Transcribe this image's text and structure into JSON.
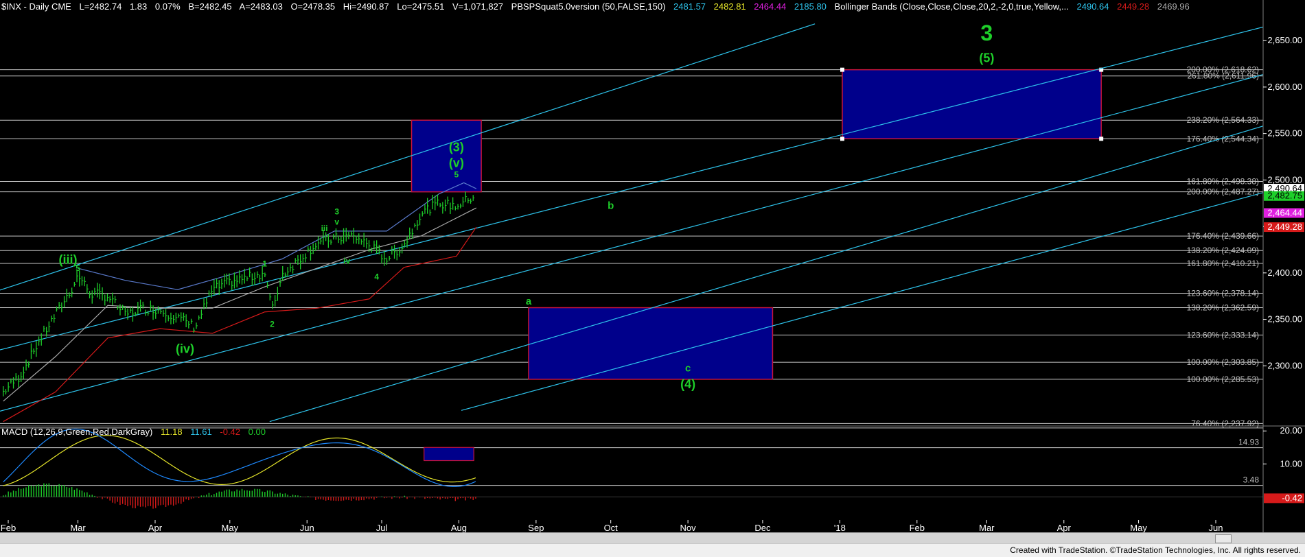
{
  "header": {
    "symbol": "$INX - Daily  CME",
    "last": "L=2482.74",
    "change": "1.83",
    "change_pct": "0.07%",
    "bid": "B=2482.45",
    "ask": "A=2483.03",
    "open": "O=2478.35",
    "high": "Hi=2490.87",
    "low": "Lo=2475.51",
    "volume": "V=1,071,827",
    "study1": "PBSPSquat5.0version (50,FALSE,150)",
    "study1_vals": [
      "2481.57",
      "2482.81",
      "2464.44",
      "2185.80"
    ],
    "study2": "Bollinger Bands (Close,Close,Close,20,2,-2,0,true,Yellow,...",
    "study2_vals": [
      "2490.64",
      "2449.28",
      "2469.96"
    ]
  },
  "macd_header": {
    "label": "MACD (12,26,9,Green,Red,DarkGray)",
    "vals": [
      "11.18",
      "11.61",
      "-0.42",
      "0.00"
    ]
  },
  "footer": {
    "text": "Created with TradeStation. ©TradeStation Technologies, Inc. All rights reserved."
  },
  "colors": {
    "background": "#000000",
    "channel": "#2ec4ec",
    "fib_line": "#c8c8c8",
    "box_fill": "#00008b",
    "box_border": "#c8143c",
    "wave_green": "#1ecf2a",
    "bb_mid": "#a9a9a9",
    "bb_upper": "#5a7acc",
    "bb_lower": "#d61a1a",
    "macd_line": "#1e8aff",
    "signal_line": "#e6e62a",
    "hist_pos": "#1ecf2a",
    "hist_neg": "#d61a1a"
  },
  "chart_data": [
    {
      "type": "line",
      "title": "$INX - Daily",
      "x_axis_labels": [
        "Feb",
        "Mar",
        "Apr",
        "May",
        "Jun",
        "Jul",
        "Aug",
        "Sep",
        "Oct",
        "Nov",
        "Dec",
        "'18",
        "Feb",
        "Mar",
        "Apr",
        "May",
        "Jun"
      ],
      "y_ticks": [
        "2,650.00",
        "2,600.00",
        "2,550.00",
        "2,500.00",
        "2,450.00",
        "2,400.00",
        "2,350.00",
        "2,300.00"
      ],
      "ylim": [
        2236,
        2680
      ],
      "price_path": [
        [
          "2017-01-30",
          2272
        ],
        [
          "2017-02-06",
          2290
        ],
        [
          "2017-02-13",
          2325
        ],
        [
          "2017-02-20",
          2355
        ],
        [
          "2017-02-27",
          2385
        ],
        [
          "2017-03-01",
          2398
        ],
        [
          "2017-03-06",
          2378
        ],
        [
          "2017-03-13",
          2375
        ],
        [
          "2017-03-20",
          2355
        ],
        [
          "2017-03-27",
          2362
        ],
        [
          "2017-04-03",
          2360
        ],
        [
          "2017-04-10",
          2352
        ],
        [
          "2017-04-17",
          2342
        ],
        [
          "2017-04-24",
          2382
        ],
        [
          "2017-05-01",
          2390
        ],
        [
          "2017-05-08",
          2395
        ],
        [
          "2017-05-15",
          2400
        ],
        [
          "2017-05-18",
          2360
        ],
        [
          "2017-05-22",
          2398
        ],
        [
          "2017-05-29",
          2415
        ],
        [
          "2017-06-05",
          2432
        ],
        [
          "2017-06-12",
          2437
        ],
        [
          "2017-06-19",
          2440
        ],
        [
          "2017-06-26",
          2430
        ],
        [
          "2017-07-03",
          2415
        ],
        [
          "2017-07-10",
          2430
        ],
        [
          "2017-07-17",
          2465
        ],
        [
          "2017-07-24",
          2475
        ],
        [
          "2017-07-31",
          2472
        ],
        [
          "2017-08-07",
          2482.74
        ]
      ],
      "bollinger": {
        "upper": [
          [
            "2017-03-01",
            2405
          ],
          [
            "2017-03-20",
            2392
          ],
          [
            "2017-04-10",
            2382
          ],
          [
            "2017-05-01",
            2398
          ],
          [
            "2017-05-22",
            2415
          ],
          [
            "2017-06-12",
            2445
          ],
          [
            "2017-07-03",
            2445
          ],
          [
            "2017-07-24",
            2485
          ],
          [
            "2017-08-03",
            2497
          ],
          [
            "2017-08-08",
            2490.64
          ]
        ],
        "middle": [
          [
            "2017-01-30",
            2262
          ],
          [
            "2017-02-20",
            2310
          ],
          [
            "2017-03-13",
            2365
          ],
          [
            "2017-04-03",
            2362
          ],
          [
            "2017-04-24",
            2362
          ],
          [
            "2017-05-15",
            2385
          ],
          [
            "2017-06-05",
            2405
          ],
          [
            "2017-06-26",
            2425
          ],
          [
            "2017-07-17",
            2440
          ],
          [
            "2017-08-08",
            2469.96
          ]
        ],
        "lower": [
          [
            "2017-01-30",
            2240
          ],
          [
            "2017-02-20",
            2272
          ],
          [
            "2017-03-13",
            2330
          ],
          [
            "2017-04-03",
            2340
          ],
          [
            "2017-04-24",
            2335
          ],
          [
            "2017-05-15",
            2358
          ],
          [
            "2017-06-05",
            2362
          ],
          [
            "2017-06-26",
            2372
          ],
          [
            "2017-07-10",
            2406
          ],
          [
            "2017-07-31",
            2418
          ],
          [
            "2017-08-08",
            2449.28
          ]
        ]
      },
      "fib_levels": [
        {
          "label": "200.00% (2,618.62)",
          "value": 2618.62
        },
        {
          "label": "261.80% (2,611.96)",
          "value": 2611.96
        },
        {
          "label": "238.20% (2,564.33)",
          "value": 2564.33
        },
        {
          "label": "176.40% (2,544.34)",
          "value": 2544.34
        },
        {
          "label": "161.80% (2,498.38)",
          "value": 2498.38
        },
        {
          "label": "200.00% (2,487.27)",
          "value": 2487.27
        },
        {
          "label": "176.40% (2,439.66)",
          "value": 2439.66
        },
        {
          "label": "138.20% (2,424.09)",
          "value": 2424.09
        },
        {
          "label": "161.80% (2,410.21)",
          "value": 2410.21
        },
        {
          "label": "123.60% (2,378.14)",
          "value": 2378.14
        },
        {
          "label": "138.20% (2,362.59)",
          "value": 2362.59
        },
        {
          "label": "123.60% (2,333.14)",
          "value": 2333.14
        },
        {
          "label": "100.00% (2,303.85)",
          "value": 2303.85
        },
        {
          "label": "100.00% (2,285.53)",
          "value": 2285.53
        },
        {
          "label": "76.40% (2,237.92)",
          "value": 2237.92
        }
      ],
      "target_boxes": [
        {
          "from": "2017-07-13",
          "to": "2017-08-10",
          "low": 2487.27,
          "high": 2564.33
        },
        {
          "from": "2017-08-29",
          "to": "2017-12-05",
          "low": 2285.53,
          "high": 2362.59
        },
        {
          "from": "2018-01-02",
          "to": "2018-04-16",
          "low": 2544.34,
          "high": 2618.62
        }
      ],
      "channel_lines": [
        {
          "from": [
            "2017-01-27",
            2380
          ],
          "to": [
            "2017-12-22",
            2668
          ]
        },
        {
          "from": [
            "2017-01-27",
            2316
          ],
          "to": [
            "2018-06-25",
            2668
          ]
        },
        {
          "from": [
            "2017-01-27",
            2250
          ],
          "to": [
            "2018-06-25",
            2617
          ]
        },
        {
          "from": [
            "2017-05-17",
            2240
          ],
          "to": [
            "2018-06-25",
            2562
          ]
        },
        {
          "from": [
            "2017-08-02",
            2252
          ],
          "to": [
            "2018-06-25",
            2490
          ]
        }
      ],
      "wave_labels": [
        {
          "text": "(iii)",
          "date": "2017-02-25",
          "value": 2410
        },
        {
          "text": "5",
          "date": "2017-03-01",
          "value": 2402
        },
        {
          "text": "(iv)",
          "date": "2017-04-13",
          "value": 2314
        },
        {
          "text": "1",
          "date": "2017-05-15",
          "value": 2407
        },
        {
          "text": "2",
          "date": "2017-05-18",
          "value": 2342
        },
        {
          "text": "iii",
          "date": "2017-06-08",
          "value": 2445
        },
        {
          "text": "3",
          "date": "2017-06-13",
          "value": 2463
        },
        {
          "text": "v",
          "date": "2017-06-13",
          "value": 2452
        },
        {
          "text": "iv",
          "date": "2017-06-17",
          "value": 2410
        },
        {
          "text": "4",
          "date": "2017-06-29",
          "value": 2393
        },
        {
          "text": "(3)",
          "date": "2017-07-31",
          "value": 2531
        },
        {
          "text": "(v)",
          "date": "2017-07-31",
          "value": 2514
        },
        {
          "text": "5",
          "date": "2017-07-31",
          "value": 2503
        },
        {
          "text": "b",
          "date": "2017-10-01",
          "value": 2469
        },
        {
          "text": "a",
          "date": "2017-08-29",
          "value": 2366
        },
        {
          "text": "c",
          "date": "2017-11-01",
          "value": 2294
        },
        {
          "text": "(4)",
          "date": "2017-11-01",
          "value": 2276
        },
        {
          "text": "3",
          "date": "2018-03-01",
          "value": 2650
        },
        {
          "text": "(5)",
          "date": "2018-03-01",
          "value": 2627
        }
      ],
      "price_flags": [
        {
          "text": "2,490.64",
          "value": 2490.64,
          "color": "#ffffff",
          "text_color": "#000000"
        },
        {
          "text": "2,482.75",
          "value": 2482.75,
          "color": "#1ecf2a",
          "text_color": "#000000"
        },
        {
          "text": "2,464.44",
          "value": 2464.44,
          "color": "#e020e0",
          "text_color": "#ffffff"
        },
        {
          "text": "2,449.28",
          "value": 2449.28,
          "color": "#d61a1a",
          "text_color": "#ffffff"
        }
      ]
    },
    {
      "type": "line",
      "title": "MACD (12,26,9,Green,Red,DarkGray)",
      "y_ticks": [
        "20.00",
        "10.00"
      ],
      "ylim": [
        -7,
        22
      ],
      "ref_levels": [
        {
          "label": "",
          "value": 20.9
        },
        {
          "label": "14.93",
          "value": 14.93
        },
        {
          "label": "3.48",
          "value": 3.48
        }
      ],
      "flag": {
        "text": "-0.42",
        "value": -0.42
      },
      "box": {
        "from": "2017-07-18",
        "to": "2017-08-07",
        "low": 11,
        "high": 15
      }
    }
  ]
}
